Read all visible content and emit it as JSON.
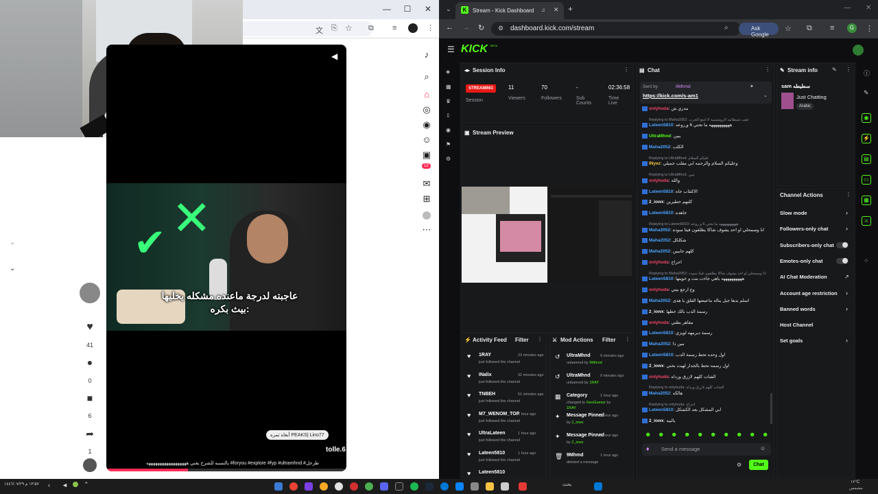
{
  "left_browser": {
    "controls": [
      "—",
      "☐",
      "✕"
    ],
    "toolbar_icons": [
      "translate-icon",
      "install-icon",
      "star-icon",
      "extensions-icon",
      "media-icon",
      "avatar-icon",
      "menu-icon"
    ]
  },
  "tiktok_video": {
    "caption_line1": "عاجبته لدرجة ماعنده مشكله يخليها",
    "caption_line2": "بيث بكره:",
    "badge_text": "أبغاه تمره PEAKS| Lino77",
    "username": "tolle.6",
    "description": "بالنسبه للشرح يعني ههههههههههههههههههه #foryou #explore #fyp #ultramhnd #طرحل",
    "progress": 0.34
  },
  "tiktok_actions": {
    "likes": "41",
    "comments": "0",
    "saves": "6",
    "shares": "1"
  },
  "tiktok_side_badge": "12",
  "right_browser": {
    "tab_title": "Stream - Kick Dashboard",
    "url": "dashboard.kick.com/stream",
    "ask_google": "Ask Google",
    "profile_letter": "G"
  },
  "kick": {
    "logo": "KICK",
    "logo_sup": "BETA",
    "session": {
      "title": "Session Info",
      "status": "STREAMING",
      "status_sub": "Session",
      "stats": [
        {
          "value": "11",
          "label": "Viewers"
        },
        {
          "value": "70",
          "label": "Followers"
        },
        {
          "value": "-",
          "label": "Sub Counts"
        },
        {
          "value": "02:36:58",
          "label": "Time Live"
        }
      ]
    },
    "preview_title": "Stream Preview",
    "activity": {
      "title": "Activity Feed",
      "filter": "Filter",
      "items": [
        {
          "user": "1RAY",
          "time": "23 minutes ago",
          "desc": "just followed the channel"
        },
        {
          "user": "INalix",
          "time": "32 minutes ago",
          "desc": "just followed the channel"
        },
        {
          "user": "TNBEH",
          "time": "51 minutes ago",
          "desc": "just followed the channel"
        },
        {
          "user": "M7_WENOM_TOP",
          "time": "1 hour ago",
          "desc": "just followed the channel"
        },
        {
          "user": "UltraLateen",
          "time": "1 hour ago",
          "desc": "just followed the channel"
        },
        {
          "user": "Lateen5810",
          "time": "1 hour ago",
          "desc": "just followed the channel"
        },
        {
          "user": "Lateen5810",
          "time": "",
          "desc": ""
        }
      ]
    },
    "mod_actions": {
      "title": "Mod Actions",
      "filter": "Filter",
      "items": [
        {
          "title": "UltraMhnd",
          "time": "9 minutes ago",
          "desc": "unbanned by",
          "by": "9Mhmd"
        },
        {
          "title": "UltraMhnd",
          "time": "9 minutes ago",
          "desc": "unbanned by",
          "by": "1RAY"
        },
        {
          "title": "Category",
          "time": "1 hour ago",
          "desc": "changed to",
          "by": "GeoGuessr",
          "extra": "by",
          "by2": "1RAY"
        },
        {
          "title": "Message Pinned",
          "time": "1 hour ago",
          "desc": "by",
          "by": "2_iowx"
        },
        {
          "title": "Message Pinned",
          "time": "1 hour ago",
          "desc": "by",
          "by": "2_iowx"
        },
        {
          "title": "9Mhmd",
          "time": "1 hour ago",
          "desc": "deleted a message",
          "by": ""
        }
      ]
    },
    "chat": {
      "title": "Chat",
      "pinned_by": "Sent by",
      "pinned_user": "9Mhmd",
      "pinned_link": "https://kick.com/s-am1",
      "input_placeholder": "Send a message",
      "send": "Chat",
      "messages": [
        {
          "reply": "",
          "user": "onlyhuda",
          "color": "#f0446a",
          "text": "مدري ش"
        },
        {
          "reply": "Replying to Maha2052: عقب شيطانيه الرومنسيه لا امنع الحرب",
          "user": "",
          "color": "",
          "text": ""
        },
        {
          "reply": "",
          "user": "Lateen5810",
          "color": "#4aa3ff",
          "text": "ههههههههههه ما تحتي 6 و ٍروعه"
        },
        {
          "reply": "",
          "user": "UltraMhnd",
          "color": "#53fc18",
          "text": "يبين"
        },
        {
          "reply": "",
          "user": "Maha2052",
          "color": "#4aa3ff",
          "text": "الكلب"
        },
        {
          "reply": "Replying to UltraMhnd: عليكم السلام",
          "user": "",
          "color": "",
          "text": ""
        },
        {
          "reply": "",
          "user": "INyez",
          "color": "#f5c542",
          "text": "وعليكم السلام والرحمه ابي مقلب جميلي"
        },
        {
          "reply": "Replying to UltraMhnd: يبين",
          "user": "",
          "color": "",
          "text": ""
        },
        {
          "reply": "",
          "user": "onlyhuda",
          "color": "#f0446a",
          "text": "والله"
        },
        {
          "reply": "",
          "user": "Lateen5810",
          "color": "#4aa3ff",
          "text": "الاكتئاب جاه"
        },
        {
          "reply": "",
          "user": "2_iowx",
          "color": "#eeeeee",
          "text": "كلبهم خطيرين"
        },
        {
          "reply": "",
          "user": "Lateen5810",
          "color": "#4aa3ff",
          "text": "جاهده"
        },
        {
          "reply": "Replying to Lateen5810: ههههههههههه ما تحتي 6 و روعه",
          "user": "",
          "color": "",
          "text": ""
        },
        {
          "reply": "",
          "user": "Maha2052",
          "color": "#4aa3ff",
          "text": "انا وسمحلي او احد يشوف شاكا يطلقون فيثا سوده"
        },
        {
          "reply": "",
          "user": "Maha2052",
          "color": "#4aa3ff",
          "text": "شكلكل"
        },
        {
          "reply": "",
          "user": "Maha2052",
          "color": "#4aa3ff",
          "text": "كلهم جايبين"
        },
        {
          "reply": "",
          "user": "onlyhuda",
          "color": "#f0446a",
          "text": "احراج"
        },
        {
          "reply": "Replying to Maha2052: انا وسمحلي او احد يشوف شاكا يطلقون فيثا سوده",
          "user": "",
          "color": "",
          "text": ""
        },
        {
          "reply": "",
          "user": "Lateen5810",
          "color": "#4aa3ff",
          "text": "ههههههههههه ياهي جاءت بنت و خويتها"
        },
        {
          "reply": "",
          "user": "onlyhuda",
          "color": "#f0446a",
          "text": "وع ارجع بيتي"
        },
        {
          "reply": "",
          "user": "Maha2052",
          "color": "#4aa3ff",
          "text": "اسلم بدها جبل يناله ماعيضها القلق يا هدى"
        },
        {
          "reply": "",
          "user": "2_iowx",
          "color": "#eeeeee",
          "text": "رسمة الدب بالك حطها"
        },
        {
          "reply": "",
          "user": "onlyhuda",
          "color": "#f0446a",
          "text": "مقاهر بطني"
        },
        {
          "reply": "",
          "user": "Lateen5810",
          "color": "#4aa3ff",
          "text": "رسمة ديرمهه لويزي"
        },
        {
          "reply": "",
          "user": "Maha2052",
          "color": "#4aa3ff",
          "text": "مين ذا"
        },
        {
          "reply": "",
          "user": "Lateen5810",
          "color": "#4aa3ff",
          "text": "اول وحده تحط رسمة الدب"
        },
        {
          "reply": "",
          "user": "2_iowx",
          "color": "#eeeeee",
          "text": "اول رسمه تحط بالجدار لهيت بحني"
        },
        {
          "reply": "",
          "user": "onlyhuda",
          "color": "#f0446a",
          "text": "الشات كلهم لازرق ورداه"
        },
        {
          "reply": "Replying to onlyhuda: الشات كلهم لازرق ورداه",
          "user": "",
          "color": "",
          "text": ""
        },
        {
          "reply": "",
          "user": "Maha2052",
          "color": "#4aa3ff",
          "text": "هالكه"
        },
        {
          "reply": "Replying to onlyhuda: احراج",
          "user": "",
          "color": "",
          "text": ""
        },
        {
          "reply": "",
          "user": "Lateen5810",
          "color": "#4aa3ff",
          "text": "ابي المشكل بعد الكشكل"
        },
        {
          "reply": "",
          "user": "2_iowx",
          "color": "#eeeeee",
          "text": "يالبيه"
        }
      ]
    },
    "stream_info": {
      "title": "Stream info",
      "stream_title": "sam سطيطه",
      "category": "Just Chatting",
      "tag": "Arabic"
    },
    "channel_actions": {
      "title": "Channel Actions",
      "items": [
        {
          "label": "Slow mode",
          "kind": "chevron"
        },
        {
          "label": "Followers-only chat",
          "kind": "chevron"
        },
        {
          "label": "Subscribers-only chat",
          "kind": "toggle"
        },
        {
          "label": "Emotes-only chat",
          "kind": "toggle"
        },
        {
          "label": "AI Chat Moderation",
          "kind": "link"
        },
        {
          "label": "Account age restriction",
          "kind": "chevron"
        },
        {
          "label": "Banned words",
          "kind": "chevron"
        },
        {
          "label": "Host Channel",
          "kind": "none"
        },
        {
          "label": "Set goals",
          "kind": "chevron"
        }
      ]
    }
  },
  "taskbar": {
    "left_text": "١٣:٥٧ م ١٤٤٦/٠٧/٢٩",
    "weather_temp": "١٢°C",
    "weather_label": "مشمس",
    "search_label": "بحث"
  },
  "colors": {
    "kick_green": "#53fc18",
    "streaming_red": "#e91916",
    "tiktok_red": "#fe2c55"
  }
}
